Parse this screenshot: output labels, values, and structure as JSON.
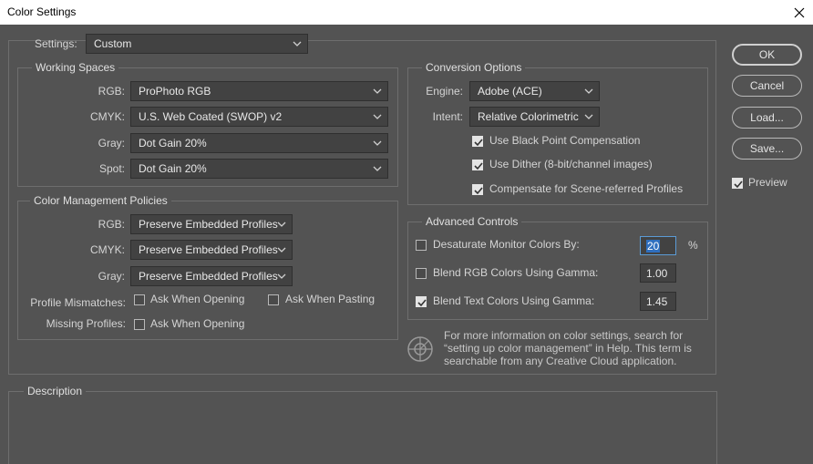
{
  "window": {
    "title": "Color Settings"
  },
  "settings": {
    "label": "Settings:",
    "value": "Custom"
  },
  "working_spaces": {
    "title": "Working Spaces",
    "rgb_label": "RGB:",
    "rgb_value": "ProPhoto RGB",
    "cmyk_label": "CMYK:",
    "cmyk_value": "U.S. Web Coated (SWOP) v2",
    "gray_label": "Gray:",
    "gray_value": "Dot Gain 20%",
    "spot_label": "Spot:",
    "spot_value": "Dot Gain 20%"
  },
  "policies": {
    "title": "Color Management Policies",
    "rgb_label": "RGB:",
    "rgb_value": "Preserve Embedded Profiles",
    "cmyk_label": "CMYK:",
    "cmyk_value": "Preserve Embedded Profiles",
    "gray_label": "Gray:",
    "gray_value": "Preserve Embedded Profiles",
    "mismatch_label": "Profile Mismatches:",
    "ask_opening_label": "Ask When Opening",
    "ask_opening_checked": false,
    "ask_pasting_label": "Ask When Pasting",
    "ask_pasting_checked": false,
    "missing_label": "Missing Profiles:",
    "missing_ask_opening_label": "Ask When Opening",
    "missing_ask_opening_checked": false
  },
  "conversion": {
    "title": "Conversion Options",
    "engine_label": "Engine:",
    "engine_value": "Adobe (ACE)",
    "intent_label": "Intent:",
    "intent_value": "Relative Colorimetric",
    "bpc_label": "Use Black Point Compensation",
    "bpc_checked": true,
    "dither_label": "Use Dither (8-bit/channel images)",
    "dither_checked": true,
    "scene_label": "Compensate for Scene-referred Profiles",
    "scene_checked": true
  },
  "advanced": {
    "title": "Advanced Controls",
    "desaturate_label": "Desaturate Monitor Colors By:",
    "desaturate_checked": false,
    "desaturate_value": "20",
    "desaturate_unit": "%",
    "blend_rgb_label": "Blend RGB Colors Using Gamma:",
    "blend_rgb_checked": false,
    "blend_rgb_value": "1.00",
    "blend_text_label": "Blend Text Colors Using Gamma:",
    "blend_text_checked": true,
    "blend_text_value": "1.45"
  },
  "info": {
    "icon": "color-settings-globe-icon",
    "line1": "For more information on color settings, search for",
    "line2": "“setting up color management” in Help. This term is",
    "line3": "searchable from any Creative Cloud application."
  },
  "description": {
    "title": "Description"
  },
  "buttons": {
    "ok": "OK",
    "cancel": "Cancel",
    "load": "Load...",
    "save": "Save..."
  },
  "preview": {
    "label": "Preview",
    "checked": true
  },
  "colors": {
    "background": "#535353",
    "titlebar": "#ffffff",
    "field": "#424242",
    "highlight": "#2f6fbf"
  }
}
